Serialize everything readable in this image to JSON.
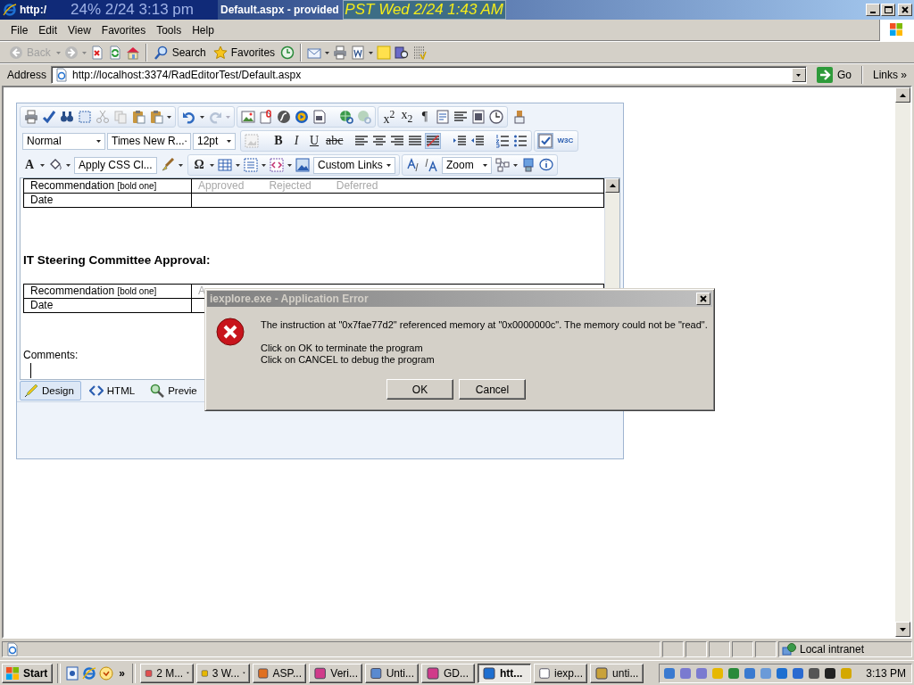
{
  "window": {
    "title_start": "http:/",
    "title_end": "Default.aspx - provided"
  },
  "clock_overlays": [
    "24% 2/24 3:13 pm",
    "PST  Wed 2/24 1:43 AM"
  ],
  "menu": [
    "File",
    "Edit",
    "View",
    "Favorites",
    "Tools",
    "Help"
  ],
  "toolbar": {
    "back": {
      "label": "Back",
      "disabled": true
    },
    "search": "Search",
    "favorites": "Favorites"
  },
  "address": {
    "label": "Address",
    "url": "http://localhost:3374/RadEditorTest/Default.aspx",
    "go": "Go",
    "links": "Links",
    "more": "»"
  },
  "editor": {
    "buttons": {
      "superscript": "x$^{2}$",
      "subscript": "x$_{2}$",
      "paragraph": "¶",
      "bold": "B",
      "italic": "I",
      "underline": "U",
      "strikethrough": "abc",
      "w3c": "W3C",
      "font_color": "A",
      "symbol": "Ω"
    },
    "dropdowns": [
      "Normal",
      "Times New R...",
      "12pt",
      "Apply CSS Cl...",
      "Custom Links",
      "Zoom"
    ],
    "document": {
      "first_table": [
        {
          "label": "Recommendation",
          "note": "[bold one]",
          "options": [
            "Approved",
            "Rejected",
            "Deferred"
          ]
        },
        {
          "label": "Date"
        }
      ],
      "heading": "IT Steering Committee Approval:",
      "second_table": [
        {
          "label": "Recommendation",
          "note": "[bold one]",
          "options": [
            "A"
          ]
        },
        {
          "label": "Date"
        }
      ],
      "comments": "Comments:"
    },
    "modes": [
      {
        "label": "Design",
        "selected": true
      },
      {
        "label": "HTML",
        "selected": false
      },
      {
        "label": "Previe",
        "selected": false
      }
    ]
  },
  "dialog": {
    "title": "iexplore.exe - Application Error",
    "message": "The instruction at \"0x7fae77d2\" referenced memory at \"0x0000000c\". The memory could not be \"read\".",
    "lines": [
      "Click on OK to terminate the program",
      "Click on CANCEL to debug the program"
    ],
    "buttons": [
      "OK",
      "Cancel"
    ]
  },
  "status_bar": {
    "zone": "Local intranet"
  },
  "taskbar": {
    "start": "Start",
    "more": "»",
    "clock": "3:13 PM",
    "tasks": [
      {
        "label": "2 M...",
        "selected": false,
        "grouped": true
      },
      {
        "label": "3 W...",
        "selected": false,
        "grouped": true
      },
      {
        "label": "ASP...",
        "selected": false,
        "grouped": false
      },
      {
        "label": "Veri...",
        "selected": false,
        "grouped": false
      },
      {
        "label": "Unti...",
        "selected": false,
        "grouped": false
      },
      {
        "label": "GD...",
        "selected": false,
        "grouped": false
      },
      {
        "label": "htt...",
        "selected": true,
        "grouped": false
      },
      {
        "label": "iexp...",
        "selected": false,
        "grouped": false
      },
      {
        "label": "unti...",
        "selected": false,
        "grouped": false
      }
    ]
  }
}
